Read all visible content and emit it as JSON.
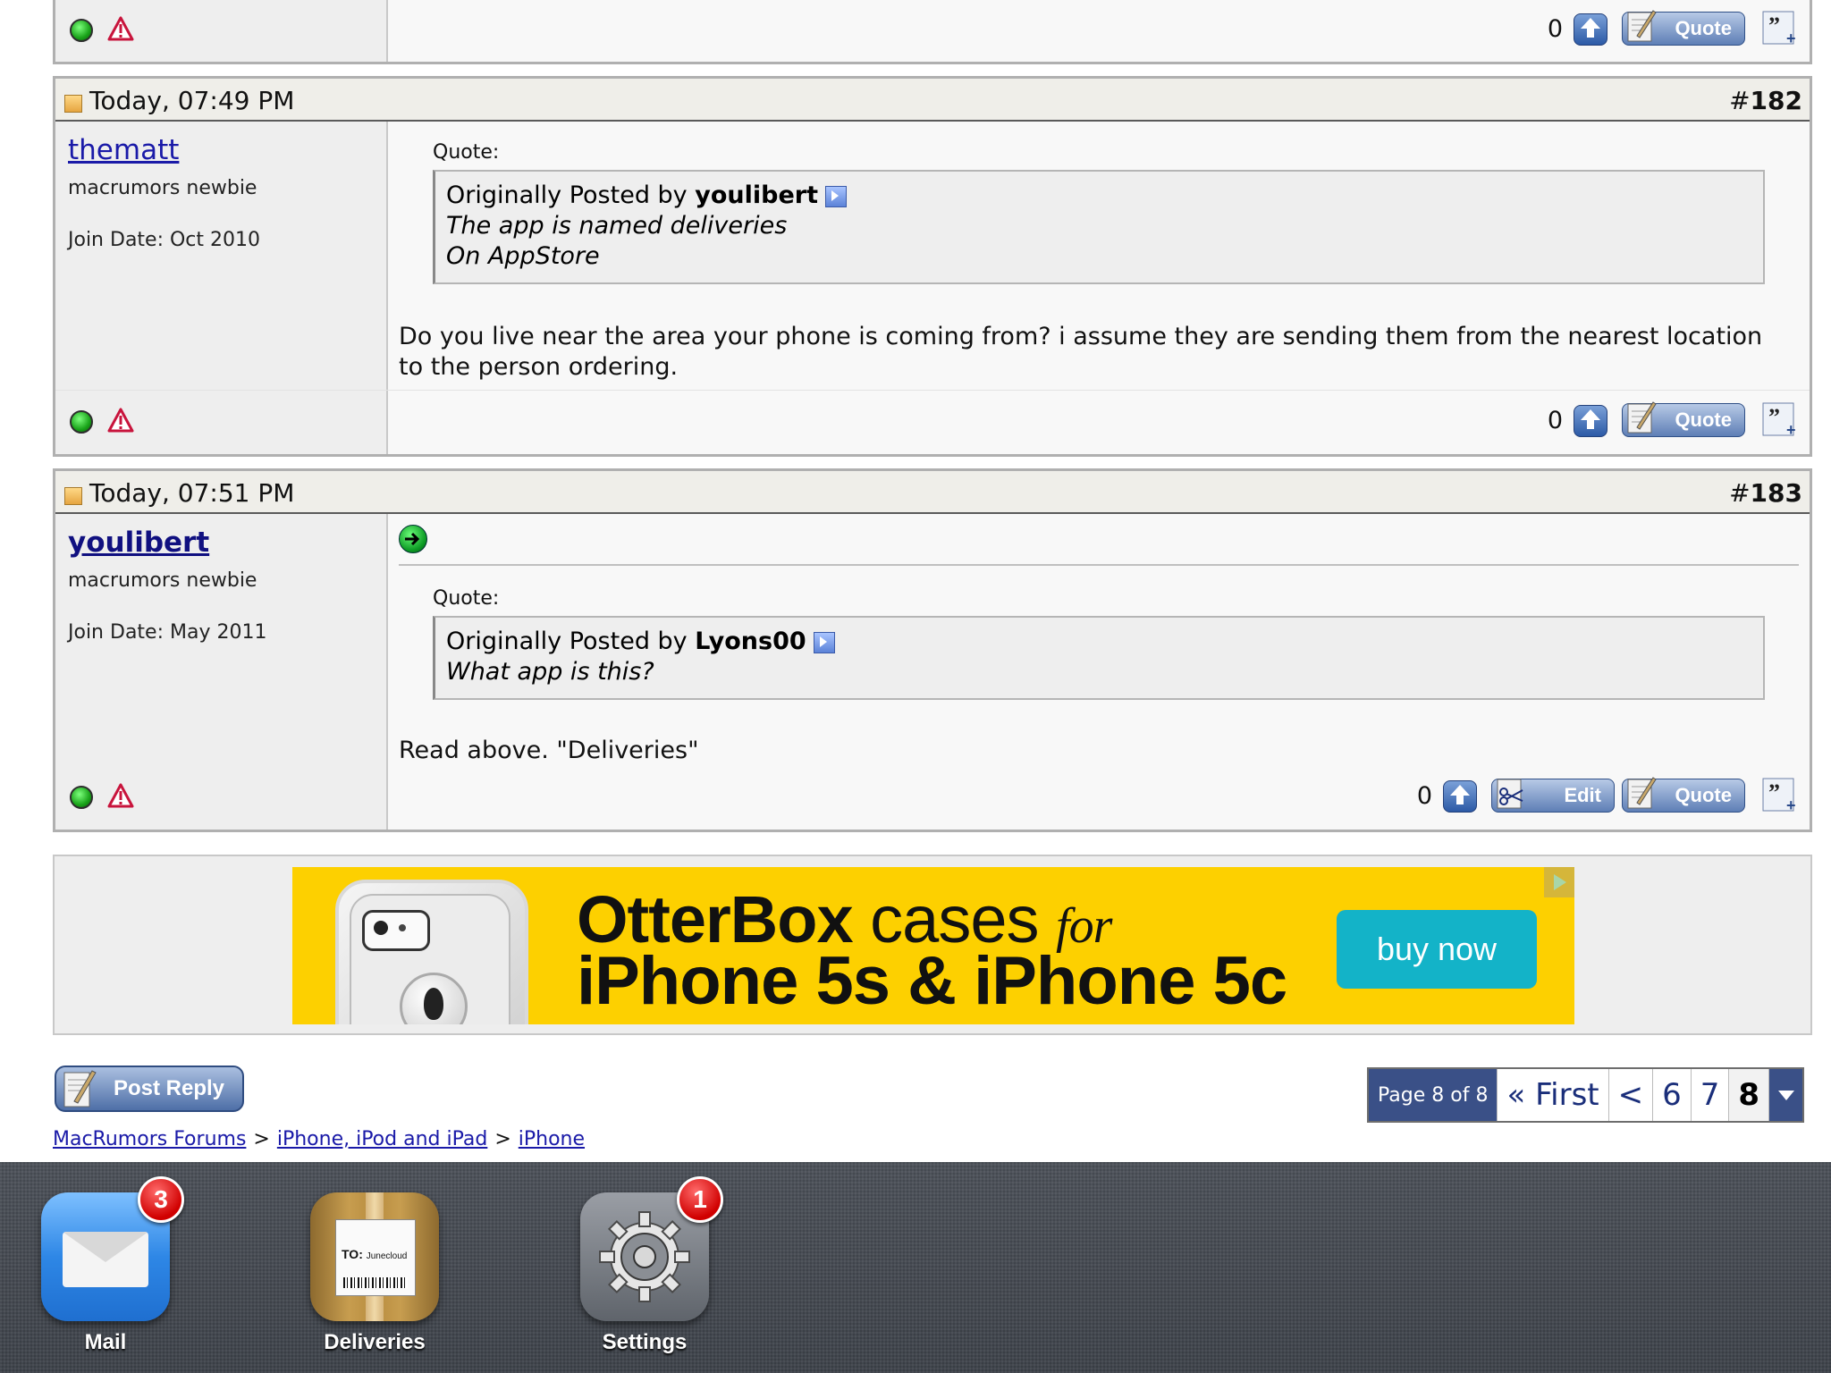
{
  "top_post_footer": {
    "rep_count": "0",
    "quote_label": "Quote"
  },
  "posts": [
    {
      "date": "Today, 07:49 PM",
      "number_prefix": "#",
      "number": "182",
      "username": "thematt",
      "user_title": "macrumors newbie",
      "join_date": "Join Date: Oct 2010",
      "quote_label": "Quote:",
      "quote_prefix": "Originally Posted by ",
      "quote_author": "youlibert",
      "quote_lines": [
        "The app is named deliveries",
        "On AppStore"
      ],
      "message": "Do you live near the area your phone is coming from? i assume they are sending them from the nearest location to the person ordering.",
      "rep_count": "0",
      "quote_button": "Quote"
    },
    {
      "date": "Today, 07:51 PM",
      "number_prefix": "#",
      "number": "183",
      "username": "youlibert",
      "user_title": "macrumors newbie",
      "join_date": "Join Date: May 2011",
      "quote_label": "Quote:",
      "quote_prefix": "Originally Posted by ",
      "quote_author": "Lyons00",
      "quote_lines": [
        "What app is this?"
      ],
      "message": "Read above. \"Deliveries\"",
      "rep_count": "0",
      "edit_button": "Edit",
      "quote_button": "Quote"
    }
  ],
  "ad": {
    "brand": "OtterBox",
    "word_cases": "cases",
    "word_for": "for",
    "line2": "iPhone 5s & iPhone 5c",
    "cta": "buy now",
    "colors": {
      "background": "#fdd000",
      "cta": "#13b3c8"
    }
  },
  "post_reply_button": "Post Reply",
  "pagination": {
    "label": "Page 8 of 8",
    "first": "« First",
    "prev": "<",
    "pages": [
      "6",
      "7",
      "8"
    ],
    "current": "8"
  },
  "breadcrumb": [
    "MacRumors Forums",
    "iPhone, iPod and iPad",
    "iPhone"
  ],
  "breadcrumb_sep": ">",
  "dock": [
    {
      "label": "Mail",
      "badge": "3",
      "icon": "mail-icon"
    },
    {
      "label": "Deliveries",
      "badge": null,
      "icon": "deliveries-icon",
      "package_to": "TO:",
      "package_name": "Junecloud"
    },
    {
      "label": "Settings",
      "badge": "1",
      "icon": "settings-icon"
    }
  ]
}
